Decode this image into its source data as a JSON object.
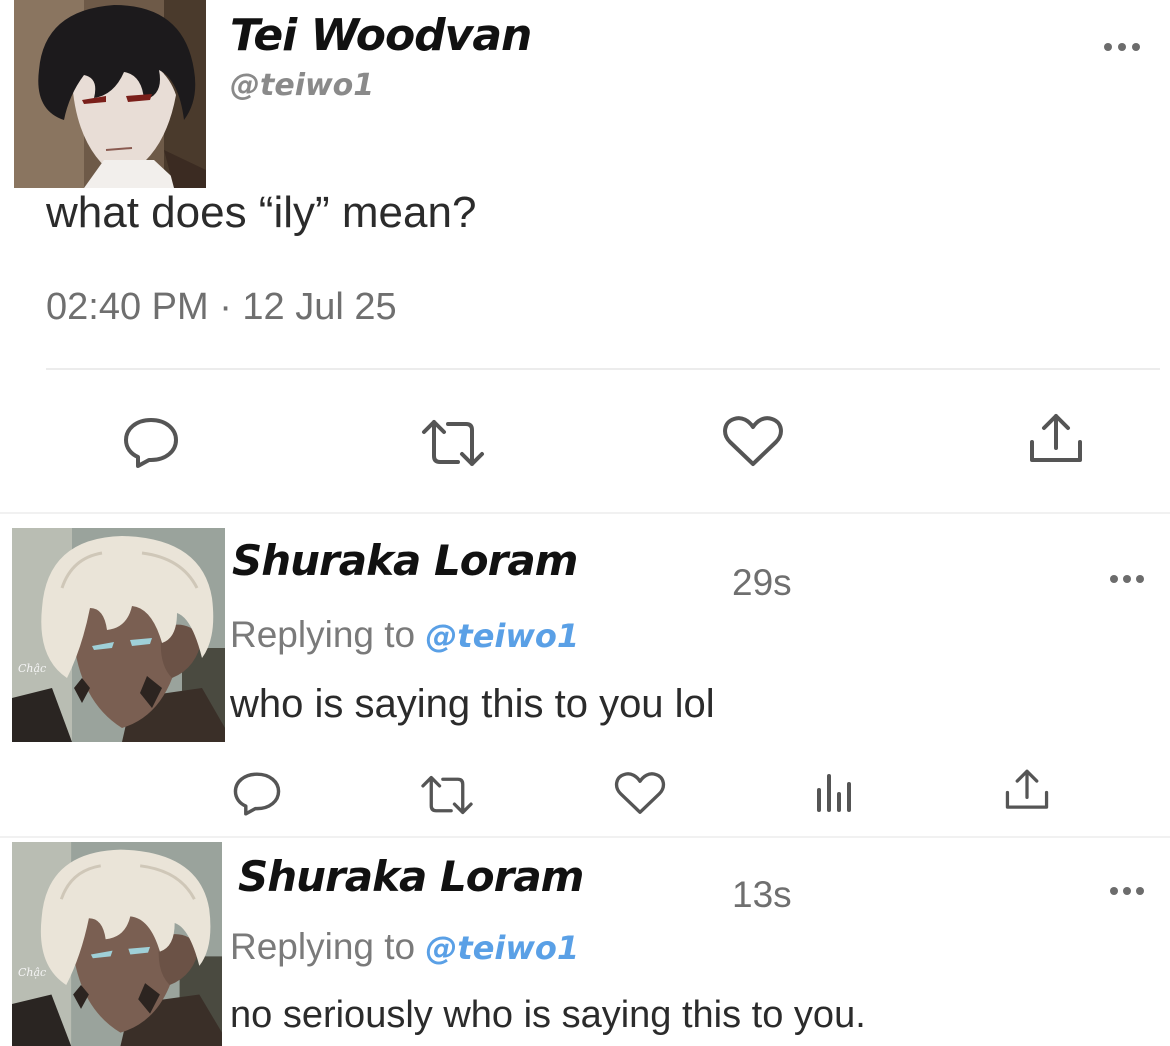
{
  "tweet": {
    "author_name": "Tei Woodvan",
    "author_handle": "@teiwo1",
    "text": "what does “ily” mean?",
    "timestamp": "02:40 PM · 12 Jul 25",
    "more_icon": "more-horizontal-icon",
    "actions": [
      "reply-icon",
      "retweet-icon",
      "like-icon",
      "share-icon"
    ]
  },
  "replies": [
    {
      "author_name": "Shuraka Loram",
      "age": "29s",
      "replying_prefix": "Replying to",
      "replying_handle": "@teiwo1",
      "text": "who is saying this to you lol",
      "avatar_caption": "Chậc",
      "actions": [
        "reply-icon",
        "retweet-icon",
        "like-icon",
        "views-icon",
        "share-icon"
      ]
    },
    {
      "author_name": "Shuraka Loram",
      "age": "13s",
      "replying_prefix": "Replying to",
      "replying_handle": "@teiwo1",
      "text": "no seriously who is saying this to you.",
      "avatar_caption": "Chậc"
    }
  ],
  "colors": {
    "mention": "#5aa0e6",
    "secondary_text": "#6f6f6f",
    "icon": "#555555"
  }
}
